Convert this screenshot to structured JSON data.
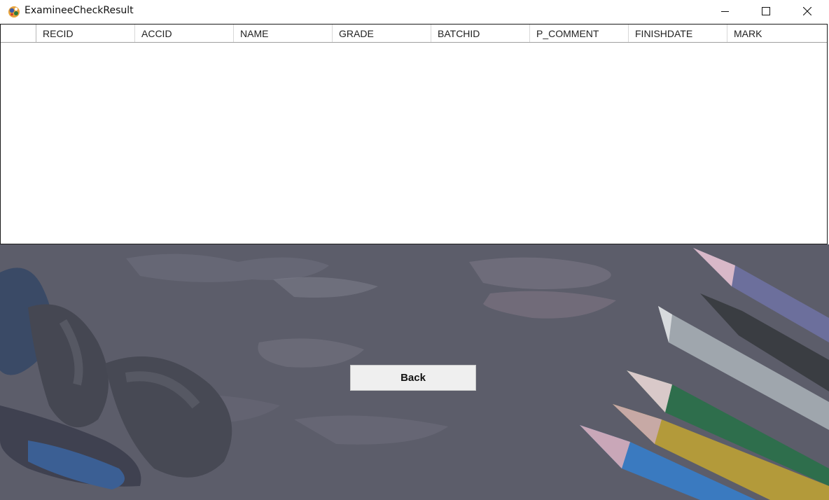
{
  "window": {
    "title": "ExamineeCheckResult",
    "icon": "app-icon",
    "controls": [
      "minimize-icon",
      "maximize-icon",
      "close-icon"
    ]
  },
  "grid": {
    "columns": [
      "RECID",
      "ACCID",
      "NAME",
      "GRADE",
      "BATCHID",
      "P_COMMENT",
      "FINISHDATE",
      "MARK"
    ],
    "rows": []
  },
  "back_button": {
    "label": "Back"
  }
}
